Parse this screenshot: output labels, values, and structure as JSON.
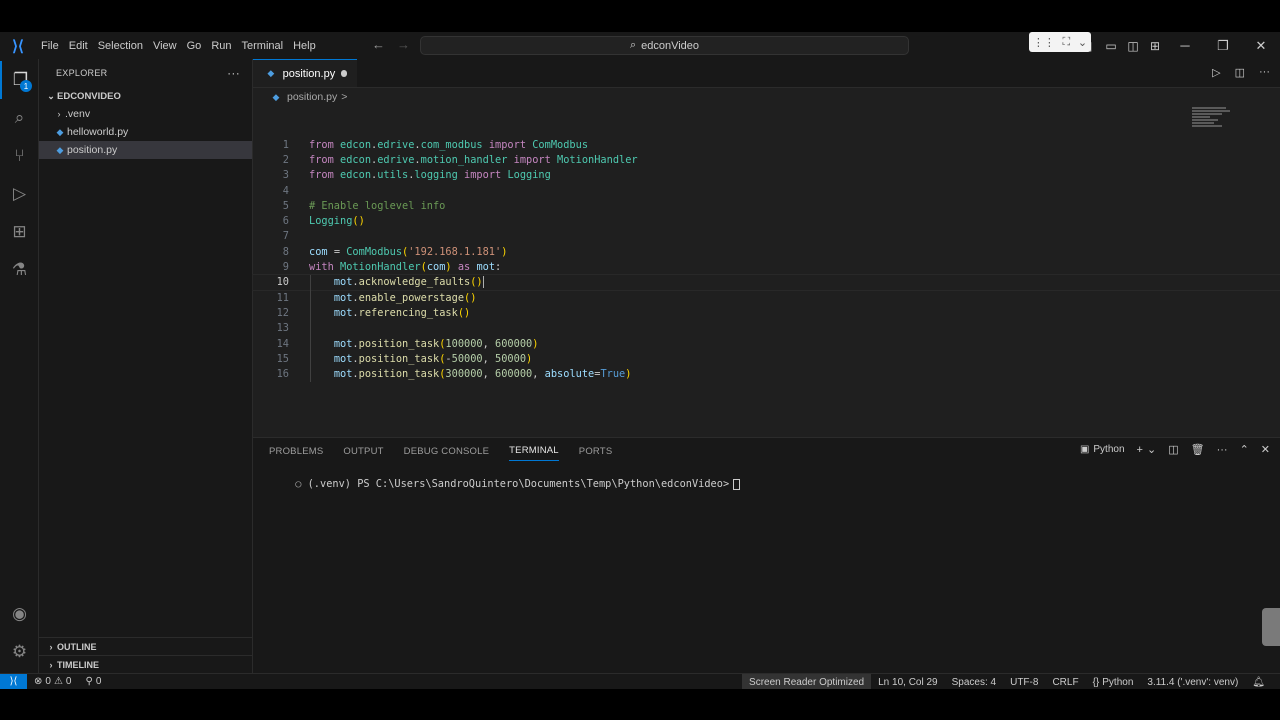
{
  "titlebar": {
    "menu": [
      "File",
      "Edit",
      "Selection",
      "View",
      "Go",
      "Run",
      "Terminal",
      "Help"
    ],
    "search_text": "edconVideo"
  },
  "sidebar": {
    "header": "EXPLORER",
    "more": "···",
    "root_folder": "EDCONVIDEO",
    "items": [
      {
        "label": ".venv",
        "type": "folder"
      },
      {
        "label": "helloworld.py",
        "type": "file"
      },
      {
        "label": "position.py",
        "type": "file",
        "selected": true
      }
    ],
    "outline": "OUTLINE",
    "timeline": "TIMELINE"
  },
  "activity": {
    "explorer_badge": "1"
  },
  "editor": {
    "tab_label": "position.py",
    "breadcrumb_file": "position.py",
    "breadcrumb_sep": ">",
    "current_line": 10
  },
  "panel": {
    "tabs": [
      "PROBLEMS",
      "OUTPUT",
      "DEBUG CONSOLE",
      "TERMINAL",
      "PORTS"
    ],
    "active_tab": "TERMINAL",
    "shell_label": "Python",
    "terminal_prompt": "(.venv) PS C:\\Users\\SandroQuintero\\Documents\\Temp\\Python\\edconVideo>"
  },
  "statusbar": {
    "errors": "0",
    "warnings": "0",
    "ports": "0",
    "screen_reader": "Screen Reader Optimized",
    "position": "Ln 10, Col 29",
    "spaces": "Spaces: 4",
    "encoding": "UTF-8",
    "eol": "CRLF",
    "language": "Python",
    "interpreter": "3.11.4 ('.venv': venv)"
  },
  "colors": {
    "accent": "#0078d4",
    "keyword": "#c586c0",
    "class": "#4ec9b0",
    "function": "#dcdcaa",
    "string": "#ce9178",
    "number": "#b5cea8",
    "comment": "#6a9955"
  }
}
